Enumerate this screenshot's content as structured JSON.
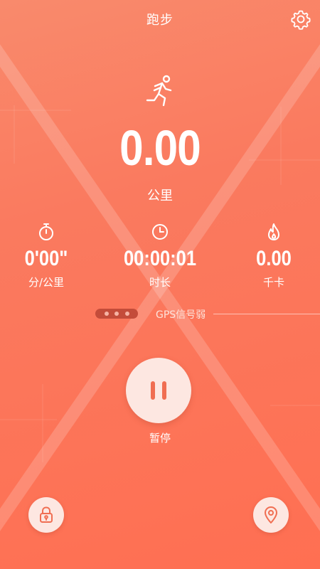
{
  "header": {
    "title": "跑步",
    "settings_icon": "gear-icon"
  },
  "main": {
    "activity_icon": "runner-icon",
    "distance_value": "0.00",
    "distance_unit": "公里"
  },
  "stats": [
    {
      "icon": "stopwatch-icon",
      "value": "0'00\"",
      "label": "分/公里"
    },
    {
      "icon": "clock-icon",
      "value": "00:00:01",
      "label": "时长"
    },
    {
      "icon": "flame-icon",
      "value": "0.00",
      "label": "千卡"
    }
  ],
  "gps": {
    "status_text": "GPS信号弱",
    "signal_dots": 3
  },
  "controls": {
    "pause_label": "暂停",
    "pause_icon": "pause-icon",
    "lock_icon": "lock-icon",
    "location_icon": "location-pin-icon"
  },
  "colors": {
    "background_top": "#f98a6c",
    "background_bottom": "#ff6f52",
    "button_fill": "#fde7e1",
    "accent": "#f06e52",
    "gps_bar": "#c44c3a"
  }
}
